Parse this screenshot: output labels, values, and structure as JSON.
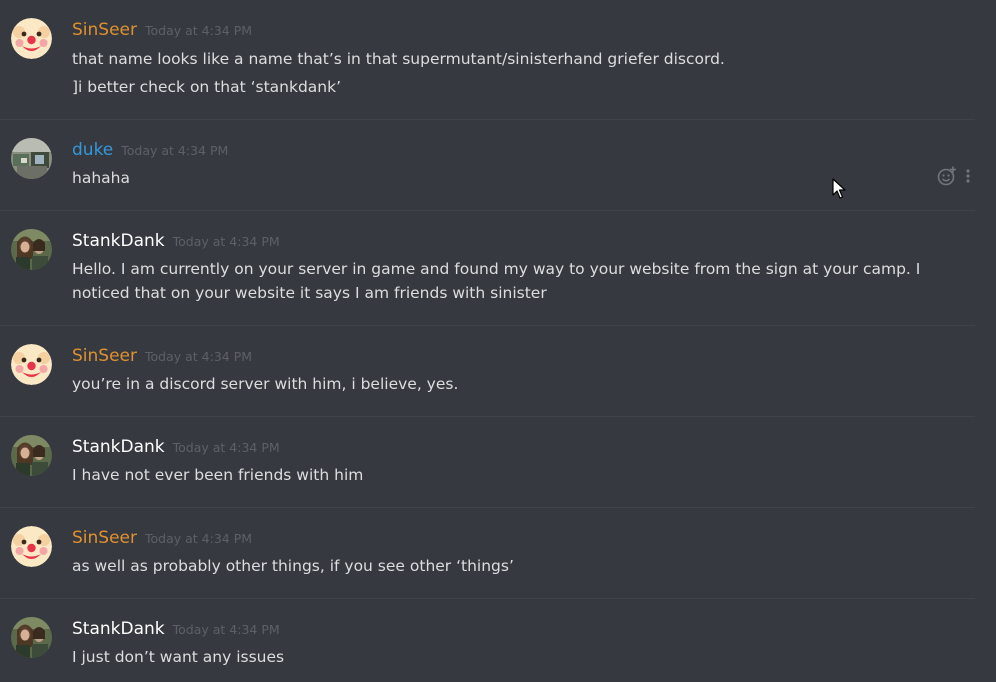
{
  "colors": {
    "background": "#36393f",
    "divider": "#40434a",
    "text": "#dcddde",
    "timestamp": "#5d6066",
    "sinseer": "#e0912f",
    "duke": "#3498db",
    "stankdank": "#ffffff"
  },
  "messages": [
    {
      "author": "SinSeer",
      "author_color": "#e0912f",
      "avatar": "clown-face",
      "timestamp": "Today at 4:34 PM",
      "lines": [
        "that name looks like a name that’s in that supermutant/sinisterhand griefer discord.",
        "]i better check on that ‘stankdank’"
      ]
    },
    {
      "author": "duke",
      "author_color": "#3498db",
      "avatar": "duke-photo",
      "timestamp": "Today at 4:34 PM",
      "lines": [
        "hahaha"
      ]
    },
    {
      "author": "StankDank",
      "author_color": "#ffffff",
      "avatar": "stankdank-photo",
      "timestamp": "Today at 4:34 PM",
      "lines": [
        "Hello. I am currently on your server in game and found my way to your website from the sign at your camp. I",
        "noticed that on your website it says I am friends with sinister"
      ]
    },
    {
      "author": "SinSeer",
      "author_color": "#e0912f",
      "avatar": "clown-face",
      "timestamp": "Today at 4:34 PM",
      "lines": [
        "you’re in a discord server with him, i believe, yes."
      ]
    },
    {
      "author": "StankDank",
      "author_color": "#ffffff",
      "avatar": "stankdank-photo",
      "timestamp": "Today at 4:34 PM",
      "lines": [
        "I have not ever been friends with him"
      ]
    },
    {
      "author": "SinSeer",
      "author_color": "#e0912f",
      "avatar": "clown-face",
      "timestamp": "Today at 4:34 PM",
      "lines": [
        "as well as probably other things, if you see other ‘things’"
      ]
    },
    {
      "author": "StankDank",
      "author_color": "#ffffff",
      "avatar": "stankdank-photo",
      "timestamp": "Today at 4:34 PM",
      "lines": [
        "I just don’t want any issues"
      ]
    }
  ],
  "hover_actions": {
    "icons": [
      "add-reaction-icon",
      "more-options-icon"
    ]
  }
}
